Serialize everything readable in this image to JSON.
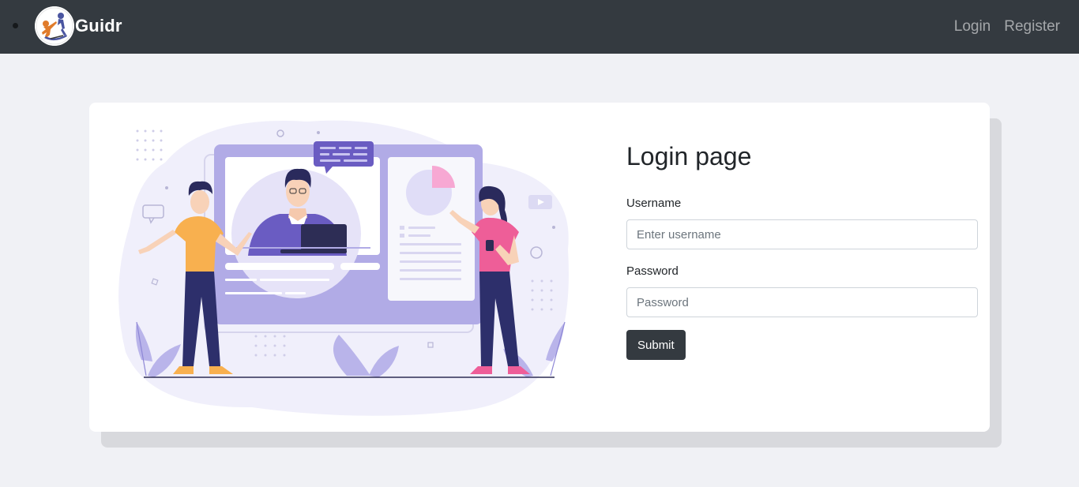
{
  "navbar": {
    "brand": "Guidr",
    "links": [
      {
        "label": "Login"
      },
      {
        "label": "Register"
      }
    ]
  },
  "login_form": {
    "title": "Login page",
    "username_label": "Username",
    "username_placeholder": "Enter username",
    "username_value": "",
    "password_label": "Password",
    "password_placeholder": "Password",
    "password_value": "",
    "submit_label": "Submit"
  },
  "colors": {
    "navbar_bg": "#343a40",
    "page_bg": "#f0f1f5",
    "accent_purple": "#7e6fd6",
    "accent_pink": "#ee5e98",
    "accent_orange": "#f8b04f"
  },
  "icons": [
    "guidr-logo",
    "chat-bubble-icon",
    "pie-chart-icon",
    "play-icon",
    "laptop-icon"
  ]
}
